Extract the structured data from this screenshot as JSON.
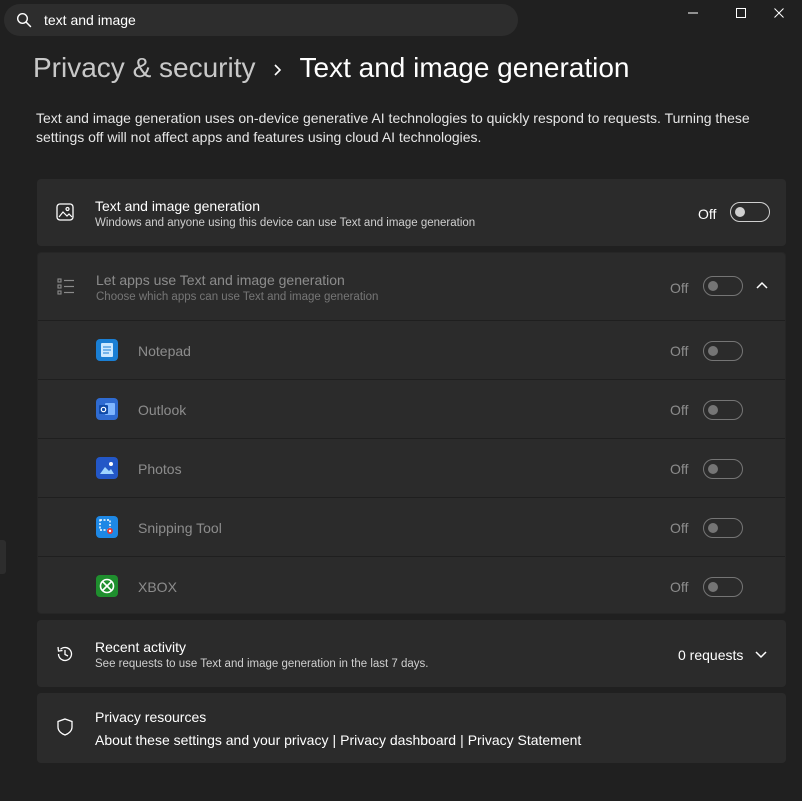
{
  "search": {
    "value": "text and image",
    "icon": "search-icon"
  },
  "window_controls": [
    "minimize-icon",
    "maximize-icon",
    "close-icon"
  ],
  "breadcrumb": {
    "parent": "Privacy & security",
    "current": "Text and image generation"
  },
  "description": "Text and image generation uses on-device generative AI technologies to quickly respond to requests. Turning these settings off will not affect apps and features using cloud AI technologies.",
  "main_setting": {
    "title": "Text and image generation",
    "subtitle": "Windows and anyone using this device can use Text and image generation",
    "state": "Off",
    "on": false
  },
  "apps_setting": {
    "title": "Let apps use Text and image generation",
    "subtitle": "Choose which apps can use Text and image generation",
    "state": "Off",
    "on": false,
    "expanded": true,
    "apps": [
      {
        "name": "Notepad",
        "state": "Off",
        "on": false,
        "color": "#1a7fd4"
      },
      {
        "name": "Outlook",
        "state": "Off",
        "on": false,
        "color": "#2f6bd1"
      },
      {
        "name": "Photos",
        "state": "Off",
        "on": false,
        "color": "#2357c7"
      },
      {
        "name": "Snipping Tool",
        "state": "Off",
        "on": false,
        "color": "#1e88e5"
      },
      {
        "name": "XBOX",
        "state": "Off",
        "on": false,
        "color": "#1f8f2e"
      }
    ]
  },
  "recent_activity": {
    "title": "Recent activity",
    "subtitle": "See requests to use Text and image generation in the last 7 days.",
    "value": "0 requests"
  },
  "privacy_resources": {
    "title": "Privacy resources",
    "links": [
      "About these settings and your privacy",
      "Privacy dashboard",
      "Privacy Statement"
    ],
    "separator": "|"
  },
  "colors": {
    "background": "#202020",
    "card": "#2b2b2b",
    "accent": "#4cc2ff"
  }
}
